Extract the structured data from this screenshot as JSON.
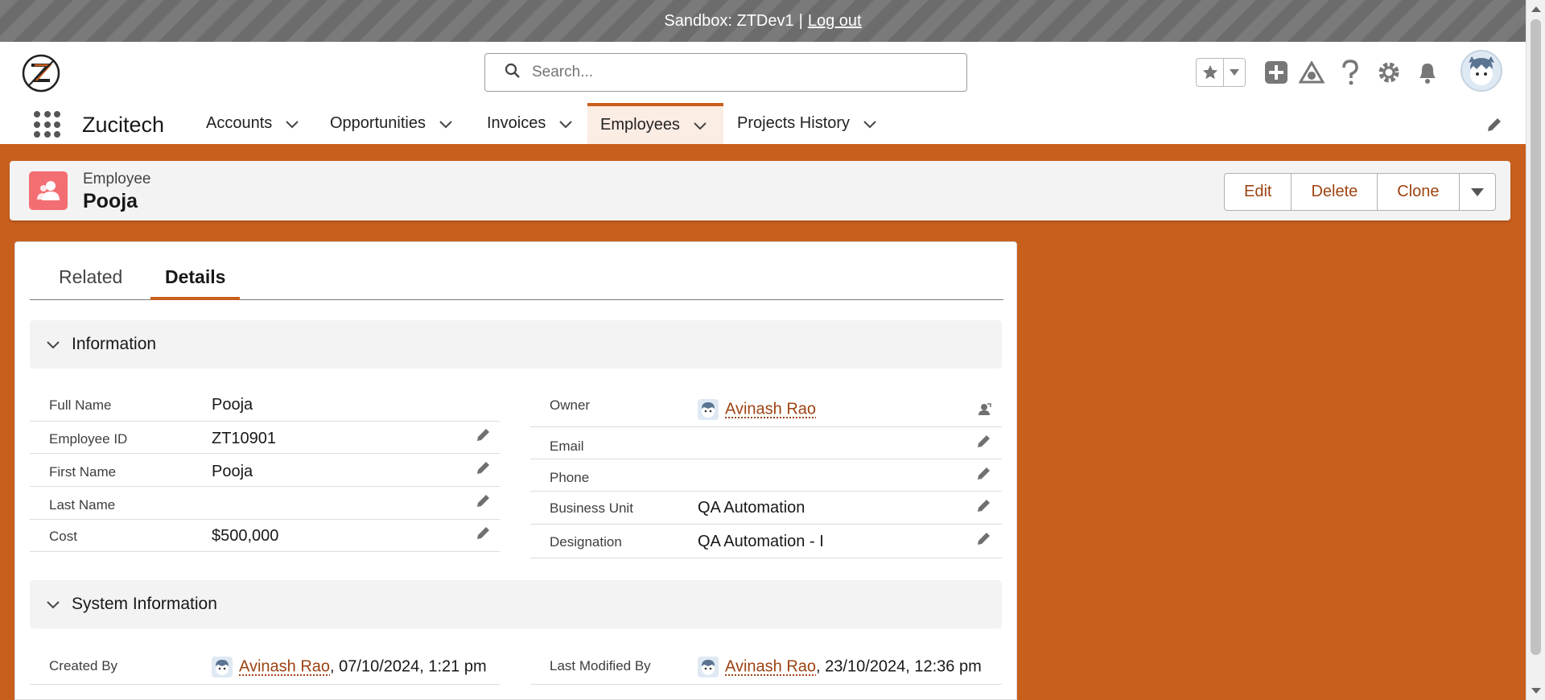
{
  "sandbox": {
    "label": "Sandbox: ZTDev1",
    "separator": "|",
    "logout": "Log out"
  },
  "header": {
    "search_placeholder": "Search...",
    "icons": [
      "star-icon",
      "chevron-down-icon",
      "add-icon",
      "trailhead-icon",
      "help-icon",
      "setup-gear-icon",
      "notifications-bell-icon",
      "user-avatar"
    ]
  },
  "nav": {
    "app_name": "Zucitech",
    "items": [
      {
        "label": "Accounts"
      },
      {
        "label": "Opportunities"
      },
      {
        "label": "Invoices"
      },
      {
        "label": "Employees",
        "active": true
      },
      {
        "label": "Projects History"
      }
    ]
  },
  "record": {
    "type": "Employee",
    "name": "Pooja",
    "actions": {
      "edit": "Edit",
      "delete": "Delete",
      "clone": "Clone"
    }
  },
  "tabs": {
    "related": "Related",
    "details": "Details"
  },
  "information": {
    "title": "Information",
    "left": [
      {
        "label": "Full Name",
        "value": "Pooja"
      },
      {
        "label": "Employee ID",
        "value": "ZT10901"
      },
      {
        "label": "First Name",
        "value": "Pooja"
      },
      {
        "label": "Last Name",
        "value": ""
      },
      {
        "label": "Cost",
        "value": "$500,000"
      }
    ],
    "right": [
      {
        "label": "Owner",
        "value": "Avinash Rao"
      },
      {
        "label": "Email",
        "value": ""
      },
      {
        "label": "Phone",
        "value": ""
      },
      {
        "label": "Business Unit",
        "value": "QA Automation"
      },
      {
        "label": "Designation",
        "value": "QA Automation - I"
      }
    ]
  },
  "system_information": {
    "title": "System Information",
    "created_by": {
      "label": "Created By",
      "user": "Avinash Rao",
      "date": ", 07/10/2024, 1:21 pm"
    },
    "last_modified_by": {
      "label": "Last Modified By",
      "user": "Avinash Rao",
      "date": ", 23/10/2024, 12:36 pm"
    }
  },
  "colors": {
    "brand": "#c95f1d",
    "link": "#9d4312",
    "record_icon": "#f36e72"
  }
}
